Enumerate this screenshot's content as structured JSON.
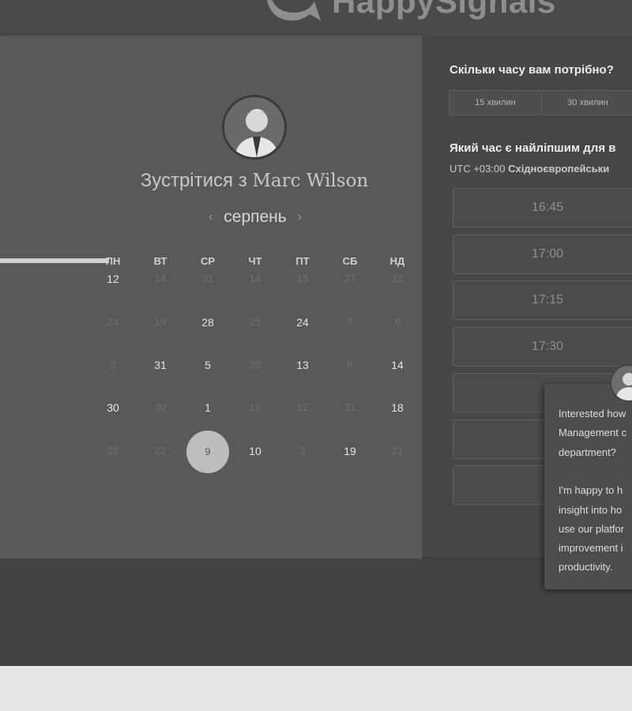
{
  "header": {
    "logo_text": "HappySignals"
  },
  "booking": {
    "title_prefix": "Зустрітися з",
    "host_name": "Marc Wilson",
    "month": "серпень",
    "prev_arrow": "‹",
    "next_arrow": "›",
    "weekdays": [
      "ПН",
      "ВТ",
      "СР",
      "ЧТ",
      "ПТ",
      "СБ",
      "НД"
    ],
    "weeks": [
      [
        {
          "d": "12",
          "on": true
        },
        {
          "d": "14",
          "on": false
        },
        {
          "d": "31",
          "on": false
        },
        {
          "d": "14",
          "on": false
        },
        {
          "d": "15",
          "on": false
        },
        {
          "d": "27",
          "on": false
        },
        {
          "d": "12",
          "on": false
        }
      ],
      [
        {
          "d": "24",
          "on": false
        },
        {
          "d": "19",
          "on": false
        },
        {
          "d": "28",
          "on": true
        },
        {
          "d": "21",
          "on": false
        },
        {
          "d": "24",
          "on": true
        },
        {
          "d": "2",
          "on": false
        },
        {
          "d": "8",
          "on": false
        }
      ],
      [
        {
          "d": "2",
          "on": false
        },
        {
          "d": "31",
          "on": true
        },
        {
          "d": "5",
          "on": true
        },
        {
          "d": "20",
          "on": false
        },
        {
          "d": "13",
          "on": true
        },
        {
          "d": "8",
          "on": false
        },
        {
          "d": "14",
          "on": true
        }
      ],
      [
        {
          "d": "30",
          "on": true
        },
        {
          "d": "30",
          "on": false
        },
        {
          "d": "1",
          "on": true
        },
        {
          "d": "16",
          "on": false
        },
        {
          "d": "12",
          "on": false
        },
        {
          "d": "31",
          "on": false
        },
        {
          "d": "18",
          "on": true
        }
      ],
      [
        {
          "d": "28",
          "on": false
        },
        {
          "d": "22",
          "on": false
        },
        {
          "d": "9",
          "on": true,
          "selected": true
        },
        {
          "d": "10",
          "on": true
        },
        {
          "d": "5",
          "on": false
        },
        {
          "d": "19",
          "on": true
        },
        {
          "d": "21",
          "on": false
        }
      ]
    ]
  },
  "scheduler": {
    "duration_question": "Скільки часу вам потрібно?",
    "durations": [
      "15 хвилин",
      "30 хвилин"
    ],
    "time_question": "Який час є найліпшим для в",
    "timezone_offset": "UTC +03:00",
    "timezone_name": "Східноєвропейськи",
    "slots": [
      "16:45",
      "17:00",
      "17:15",
      "17:30",
      "",
      "",
      ""
    ]
  },
  "chat": {
    "lines": [
      "Interested how",
      "Management c",
      "department?",
      "",
      "I'm happy to h",
      "insight into ho",
      "use our platfor",
      "improvement i",
      "productivity."
    ]
  }
}
